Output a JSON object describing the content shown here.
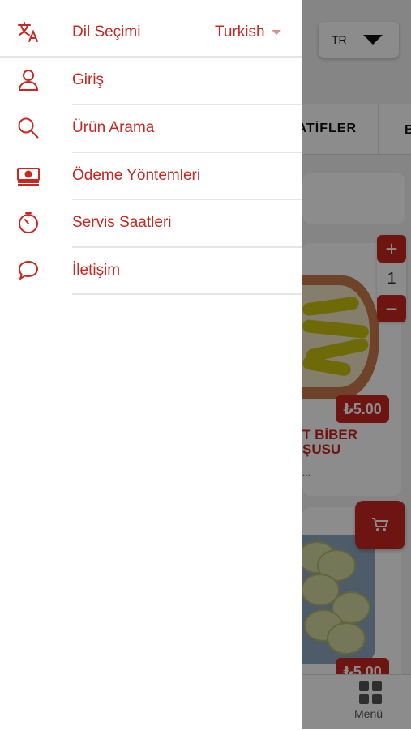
{
  "background": {
    "language_code": "TR",
    "category_tab": "RATİFLER",
    "category_tab_next": "B",
    "quantity": "1",
    "price1": "₺5.00",
    "price2": "₺5.00",
    "product_name": "T BİBER\nŞUSU",
    "product_desc": "...",
    "bottom_nav_label": "Menü"
  },
  "drawer": {
    "language_label": "Dil Seçimi",
    "language_value": "Turkish",
    "items": [
      {
        "label": "Giriş",
        "icon": "user-icon"
      },
      {
        "label": "Ürün Arama",
        "icon": "search-icon"
      },
      {
        "label": "Ödeme Yöntemleri",
        "icon": "money-icon"
      },
      {
        "label": "Servis Saatleri",
        "icon": "timer-icon"
      },
      {
        "label": "İletişim",
        "icon": "chat-icon"
      }
    ]
  },
  "colors": {
    "accent": "#c9271f",
    "overlay": "rgba(0,0,0,0.45)"
  }
}
